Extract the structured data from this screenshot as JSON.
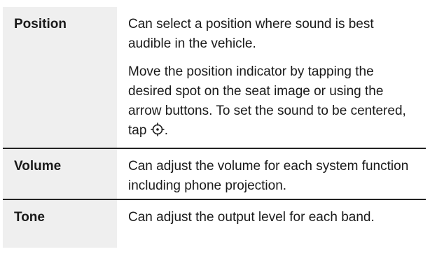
{
  "settings": {
    "rows": [
      {
        "name": "Position",
        "paragraphs": [
          "Can select a position where sound is best audible in the vehicle.",
          "Move the position indicator by tapping the desired spot on the seat image or using the arrow buttons. To set the sound to be centered, tap"
        ],
        "trailing_icon": "crosshair-center-icon",
        "trailing_text": "."
      },
      {
        "name": "Volume",
        "paragraphs": [
          "Can adjust the volume for each system function including phone projection."
        ]
      },
      {
        "name": "Tone",
        "paragraphs": [
          "Can adjust the output level for each band."
        ]
      }
    ]
  }
}
